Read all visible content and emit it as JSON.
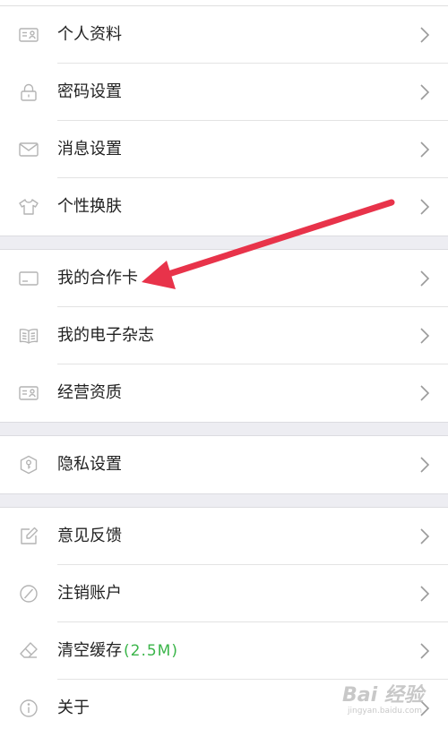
{
  "menu": {
    "group1": [
      {
        "label": "个人资料",
        "icon": "id-card-icon"
      },
      {
        "label": "密码设置",
        "icon": "lock-icon"
      },
      {
        "label": "消息设置",
        "icon": "envelope-icon"
      },
      {
        "label": "个性换肤",
        "icon": "shirt-icon"
      }
    ],
    "group2": [
      {
        "label": "我的合作卡",
        "icon": "card-icon"
      },
      {
        "label": "我的电子杂志",
        "icon": "open-book-icon"
      },
      {
        "label": "经营资质",
        "icon": "id-card-icon"
      }
    ],
    "group3": [
      {
        "label": "隐私设置",
        "icon": "shield-key-icon"
      }
    ],
    "group4": [
      {
        "label": "意见反馈",
        "icon": "edit-note-icon"
      },
      {
        "label": "注销账户",
        "icon": "prohibited-icon"
      },
      {
        "label": "清空缓存",
        "badge": "(2.5M)",
        "icon": "eraser-icon"
      },
      {
        "label": "关于",
        "icon": "info-icon"
      }
    ]
  },
  "annotation": {
    "arrow_color": "#e8334a",
    "points_to": "我的合作卡"
  },
  "colors": {
    "text": "#222222",
    "icon": "#b4b4b4",
    "badge": "#3bb54a",
    "separator_band": "#ededf2"
  },
  "watermark": {
    "main": "Bai 经验",
    "sub": "jingyan.baidu.com"
  }
}
